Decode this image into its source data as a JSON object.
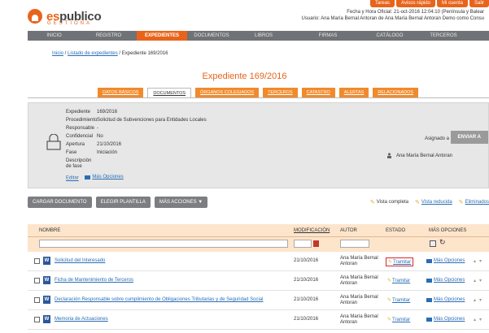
{
  "top_buttons": [
    "Tareas",
    "Avisos rápido",
    "Mi cuenta",
    "Salir"
  ],
  "logo": {
    "brand_a": "es",
    "brand_b": "publico",
    "sub": "GESTIONA"
  },
  "user_info": {
    "line1": "Fecha y Hora Oficial: 21-oct-2016 12:04:10 (Península y Balear",
    "line2": "Usuario: Ana María Bernal Antoran de Ana María Bernal Antoran Demo como Consu"
  },
  "nav": [
    "INICIO",
    "REGISTRO",
    "EXPEDIENTES",
    "DOCUMENTOS",
    "LIBROS",
    "FIRMAS",
    "CATÁLOGO",
    "TERCEROS"
  ],
  "nav_active": "EXPEDIENTES",
  "breadcrumb": {
    "inicio": "Inicio",
    "sep1": " / ",
    "listado": "Listado de expedientes",
    "sep2": " / ",
    "current": "Expediente 169/2016"
  },
  "title": "Expediente 169/2016",
  "tabs": [
    "DATOS BÁSICOS",
    "DOCUMENTOS",
    "ÓRGANOS COLEGIADOS",
    "TERCEROS",
    "CATASTRO",
    "ALERTAS",
    "RELACIONADOS"
  ],
  "tab_active": "DOCUMENTOS",
  "fields": [
    {
      "label": "Expediente",
      "value": "169/2016"
    },
    {
      "label": "Procedimiento",
      "value": "Solicitud de Subvenciones para Entidades Locales"
    },
    {
      "label": "Responsable",
      "value": "-"
    },
    {
      "label": "Confidencial",
      "value": "No"
    },
    {
      "label": "Apertura",
      "value": "21/10/2016"
    },
    {
      "label": "Fase",
      "value": "Iniciación"
    },
    {
      "label": "Descripción de fase",
      "value": ""
    }
  ],
  "panel_links": {
    "editar": "Editar",
    "mas": "Más Opciones"
  },
  "assigned_label": "Asignado a",
  "enviar": "ENVIAR A",
  "assignee": "Ana María Bernal Antoran",
  "actions": [
    "CARGAR DOCUMENTO",
    "ELEGIR PLANTILLA",
    "MÁS ACCIONES ▼"
  ],
  "views": {
    "completa": "Vista completa",
    "reducida": "Vista reducida",
    "eliminados": "Eliminados"
  },
  "table": {
    "headers": {
      "nombre": "NOMBRE",
      "modificacion": "MODIFICACIÓN",
      "autor": "AUTOR",
      "estado": "ESTADO",
      "mas": "MÁS OPCIONES"
    },
    "rows": [
      {
        "name": "Solicitud del Interesado",
        "date": "21/10/2016",
        "author": "Ana María Bernal Antoran",
        "estado": "Tramitar",
        "mas": "Más Opciones"
      },
      {
        "name": "Ficha de Mantenimiento de Terceros",
        "date": "21/10/2016",
        "author": "Ana María Bernal Antoran",
        "estado": "Tramitar",
        "mas": "Más Opciones"
      },
      {
        "name": "Declaración Responsable sobre cumplimiento de Obligaciones Tributarias y de Seguridad Social",
        "date": "21/10/2016",
        "author": "Ana María Bernal Antoran",
        "estado": "Tramitar",
        "mas": "Más Opciones"
      },
      {
        "name": "Memoria de Actuaciones",
        "date": "21/10/2016",
        "author": "Ana María Bernal Antoran",
        "estado": "Tramitar",
        "mas": "Más Opciones"
      }
    ]
  },
  "colors": {
    "accent": "#e8641b",
    "nav_bg": "#6f7276",
    "link": "#2a6db5",
    "highlight": "#d9262c"
  }
}
